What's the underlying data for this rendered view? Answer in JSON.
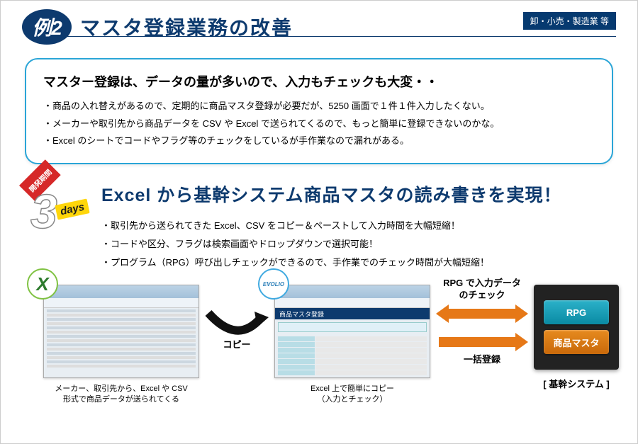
{
  "header": {
    "badge": "例2",
    "title": "マスタ登録業務の改善",
    "industry": "卸・小売・製造業 等"
  },
  "problem": {
    "title": "マスター登録は、データの量が多いので、入力もチェックも大変・・",
    "items": [
      "・商品の入れ替えがあるので、定期的に商品マスタ登録が必要だが、5250 画面で１件１件入力したくない。",
      "・メーカーや取引先から商品データを CSV や Excel で送られてくるので、もっと簡単に登録できないのかな。",
      "・Excel のシートでコードやフラグ等のチェックをしているが手作業なので漏れがある。"
    ]
  },
  "dev": {
    "ribbon": "開発期間",
    "days_label": "days"
  },
  "solution": {
    "title": "Excel から基幹システム商品マスタの読み書きを実現！",
    "items": [
      "・取引先から送られてきた Excel、CSV をコピー＆ペーストして入力時間を大幅短縮！",
      "・コードや区分、フラグは検索画面やドロップダウンで選択可能！",
      "・プログラム（RPG）呼び出しチェックができるので、手作業でのチェック時間が大幅短縮！"
    ]
  },
  "diagram": {
    "source_caption": "メーカー、取引先から、Excel や CSV\n形式で商品データが送られてくる",
    "copy_label": "コピー",
    "tool_header": "商品マスタ登録",
    "tool_caption": "Excel 上で簡単にコピー\n（入力とチェック）",
    "evolio": "EVOLIO",
    "rpg_check": "RPG で入力データ\nのチェック",
    "batch_reg": "一括登録",
    "server_rpg": "RPG",
    "server_master": "商品マスタ",
    "server_label": "[ 基幹システム ]"
  }
}
